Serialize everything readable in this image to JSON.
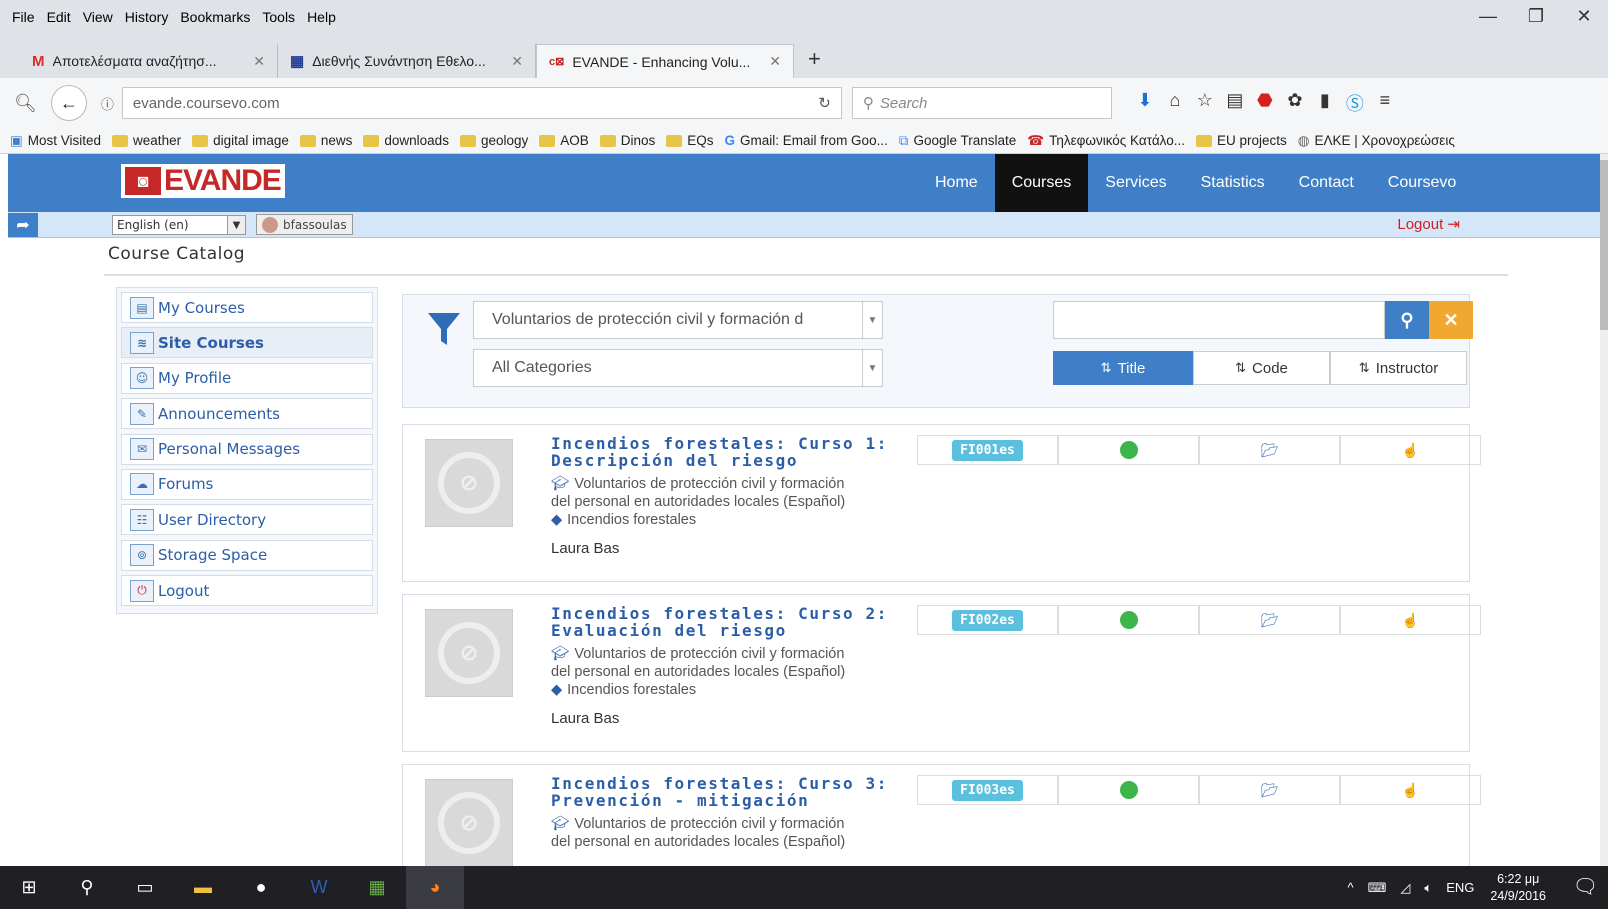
{
  "browser": {
    "menu": [
      "File",
      "Edit",
      "View",
      "History",
      "Bookmarks",
      "Tools",
      "Help"
    ],
    "window_controls": {
      "minimize": "—",
      "restore": "❐",
      "close": "✕"
    },
    "tabs": [
      {
        "icon": "M",
        "icon_color": "#d93025",
        "title": "Αποτελέσματα αναζήτησ...",
        "close": "✕"
      },
      {
        "icon": "▦",
        "icon_color": "#1f3a93",
        "title": "Διεθνής Συνάντηση Εθελο...",
        "close": "✕"
      },
      {
        "icon": "c⊠",
        "icon_color": "#c62828",
        "title": "EVANDE - Enhancing Volu...",
        "close": "✕"
      }
    ],
    "new_tab": "+",
    "url": "evande.coursevo.com",
    "search_placeholder": "Search",
    "bookmarks": [
      {
        "label": "Most Visited",
        "type": "special"
      },
      {
        "label": "weather",
        "type": "folder"
      },
      {
        "label": "digital image",
        "type": "folder"
      },
      {
        "label": "news",
        "type": "folder"
      },
      {
        "label": "downloads",
        "type": "folder"
      },
      {
        "label": "geology",
        "type": "folder"
      },
      {
        "label": "AOB",
        "type": "folder"
      },
      {
        "label": "Dinos",
        "type": "folder"
      },
      {
        "label": "EQs",
        "type": "folder"
      },
      {
        "label": "Gmail: Email from Goo...",
        "type": "google"
      },
      {
        "label": "Google Translate",
        "type": "translate"
      },
      {
        "label": "Τηλεφωνικός Κατάλο...",
        "type": "phone"
      },
      {
        "label": "EU projects",
        "type": "folder"
      },
      {
        "label": "ΕΛΚΕ | Χρονοχρεώσεις",
        "type": "globe"
      }
    ]
  },
  "site": {
    "logo_text": "EVANDE",
    "nav": [
      {
        "label": "Home",
        "active": false
      },
      {
        "label": "Courses",
        "active": true
      },
      {
        "label": "Services",
        "active": false
      },
      {
        "label": "Statistics",
        "active": false
      },
      {
        "label": "Contact",
        "active": false
      },
      {
        "label": "Coursevo",
        "active": false
      }
    ],
    "language": "English (en)",
    "username": "bfassoulas",
    "logout": "Logout"
  },
  "page_title": "Course Catalog",
  "sidebar": [
    {
      "label": "My Courses",
      "icon": "courses-icon",
      "active": false
    },
    {
      "label": "Site Courses",
      "icon": "site-courses-icon",
      "active": true
    },
    {
      "label": "My Profile",
      "icon": "profile-icon",
      "active": false
    },
    {
      "label": "Announcements",
      "icon": "announcements-icon",
      "active": false
    },
    {
      "label": "Personal Messages",
      "icon": "messages-icon",
      "active": false
    },
    {
      "label": "Forums",
      "icon": "forums-icon",
      "active": false
    },
    {
      "label": "User Directory",
      "icon": "directory-icon",
      "active": false
    },
    {
      "label": "Storage Space",
      "icon": "storage-icon",
      "active": false
    },
    {
      "label": "Logout",
      "icon": "logout-icon",
      "active": false
    }
  ],
  "filters": {
    "program": "Voluntarios de protección civil y formación d",
    "category": "All Categories",
    "search_value": "",
    "sort": [
      {
        "label": "Title",
        "active": true
      },
      {
        "label": "Code",
        "active": false
      },
      {
        "label": "Instructor",
        "active": false
      }
    ]
  },
  "courses": [
    {
      "title_line1": "Incendios forestales: Curso 1:",
      "title_line2": "Descripción del riesgo",
      "program_line1": "Voluntarios de protección civil y formación",
      "program_line2": "del personal en autoridades locales (Español)",
      "tag": "Incendios forestales",
      "instructor": "Laura Bas",
      "code": "FI001es"
    },
    {
      "title_line1": "Incendios forestales: Curso 2:",
      "title_line2": "Evaluación del riesgo",
      "program_line1": "Voluntarios de protección civil y formación",
      "program_line2": "del personal en autoridades locales (Español)",
      "tag": "Incendios forestales",
      "instructor": "Laura Bas",
      "code": "FI002es"
    },
    {
      "title_line1": "Incendios forestales: Curso 3:",
      "title_line2": "Prevención - mitigación",
      "program_line1": "Voluntarios de protección civil y formación",
      "program_line2": "del personal en autoridades locales (Español)",
      "tag": "",
      "instructor": "",
      "code": "FI003es"
    }
  ],
  "taskbar": {
    "language": "ENG",
    "time": "6:22 μμ",
    "date": "24/9/2016"
  },
  "colors": {
    "header_blue": "#3f7fc8",
    "nav_active": "#111111",
    "search_blue": "#3f7fc8",
    "clear_orange": "#f0a830",
    "code_badge": "#5bc0de",
    "status_green": "#3cb54a",
    "logout_red": "#d42020"
  }
}
